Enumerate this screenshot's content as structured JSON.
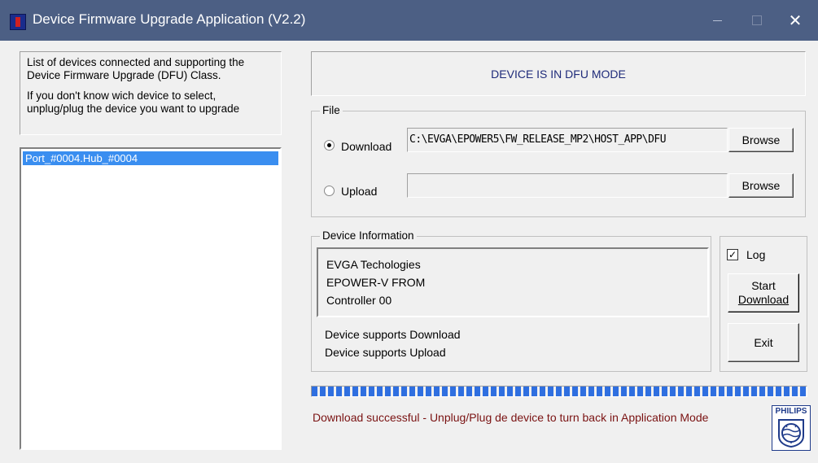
{
  "window": {
    "title": "Device Firmware Upgrade Application (V2.2)",
    "close_glyph": "✕"
  },
  "left": {
    "info_line1": "List of devices connected and supporting the Device Firmware Upgrade (DFU) Class.",
    "info_line2": "If you don't know wich device to select, unplug/plug the device you want to upgrade",
    "devices": [
      "Port_#0004.Hub_#0004"
    ]
  },
  "status": {
    "mode_text": "DEVICE IS IN DFU MODE"
  },
  "file": {
    "legend": "File",
    "download_label": "Download",
    "download_path": "C:\\EVGA\\EPOWER5\\FW_RELEASE_MP2\\HOST_APP\\DFU",
    "download_browse": "Browse",
    "upload_label": "Upload",
    "upload_path": "",
    "upload_browse": "Browse",
    "selected": "download"
  },
  "device_info": {
    "legend": "Device Information",
    "lines": [
      "EVGA Techologies",
      "EPOWER-V FROM",
      "Controller 00"
    ],
    "supports": [
      "Device supports Download",
      "Device supports Upload"
    ]
  },
  "actions": {
    "log_label": "Log",
    "log_checked": true,
    "start_line1": "Start",
    "start_line2": "Download",
    "exit_label": "Exit"
  },
  "progress": {
    "percent": 100,
    "accent": "#2f6fe0"
  },
  "message": "Download successful - Unplug/Plug de device to turn back in Application Mode",
  "logo": {
    "text": "PHILIPS"
  }
}
